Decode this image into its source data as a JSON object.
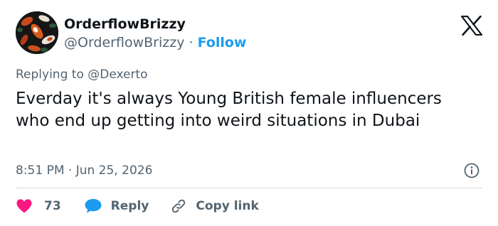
{
  "author": {
    "display_name": "OrderflowBrizzy",
    "handle": "@OrderflowBrizzy",
    "separator": "·",
    "follow_label": "Follow"
  },
  "reply_context": {
    "prefix": "Replying to",
    "mention": "@Dexerto"
  },
  "tweet": {
    "text": "Everday it's always Young British female influencers who end up getting into weird situations in Dubai",
    "time": "8:51 PM",
    "separator": "·",
    "date": "Jun 25, 2026"
  },
  "actions": {
    "like_count": "73",
    "reply_label": "Reply",
    "copy_link_label": "Copy link"
  },
  "icons": {
    "logo": "x-logo-icon",
    "info": "info-icon",
    "like": "heart-icon",
    "reply": "speech-bubble-icon",
    "copy": "link-icon"
  },
  "colors": {
    "text_primary": "#0f1419",
    "text_secondary": "#536471",
    "follow_blue": "#1d9bf0",
    "like_pink": "#f91880",
    "divider": "#cfd9de"
  }
}
